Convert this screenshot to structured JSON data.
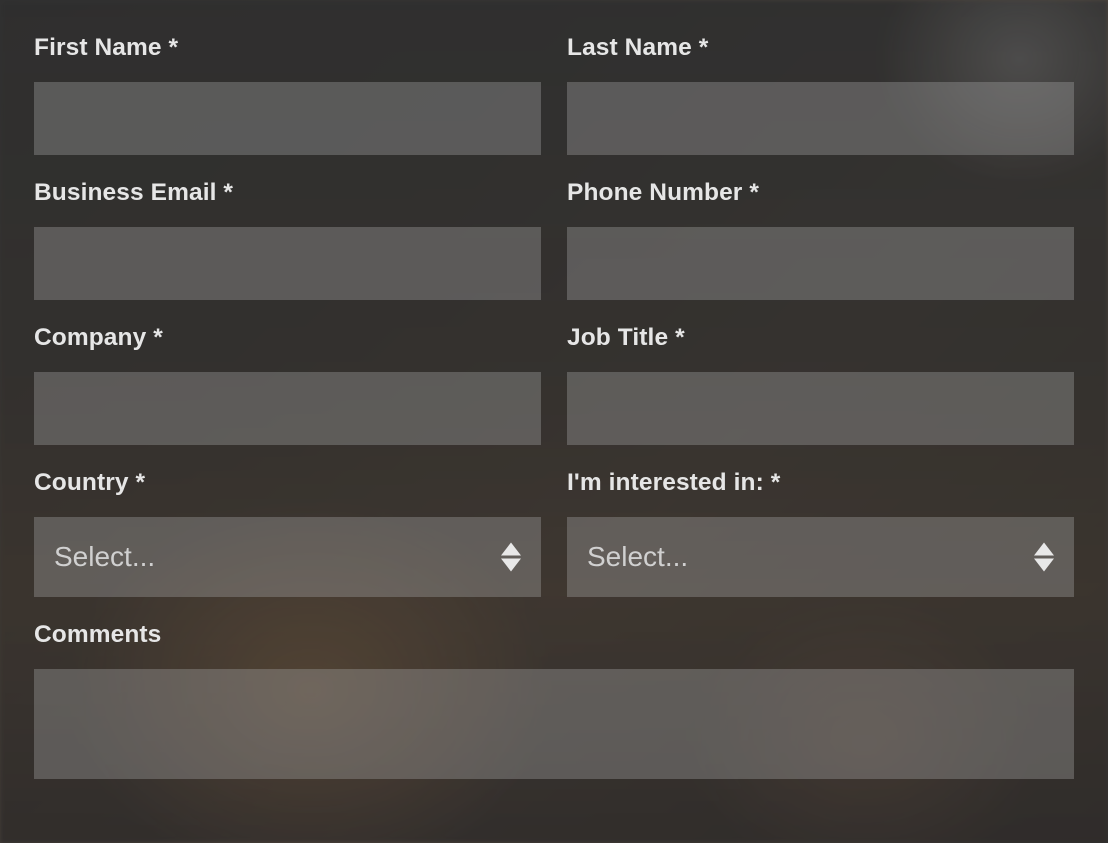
{
  "form": {
    "first_name": {
      "label": "First Name *",
      "value": ""
    },
    "last_name": {
      "label": "Last Name *",
      "value": ""
    },
    "business_email": {
      "label": "Business Email *",
      "value": ""
    },
    "phone_number": {
      "label": "Phone Number *",
      "value": ""
    },
    "company": {
      "label": "Company *",
      "value": ""
    },
    "job_title": {
      "label": "Job Title *",
      "value": ""
    },
    "country": {
      "label": "Country *",
      "selected": "Select..."
    },
    "interested_in": {
      "label": "I'm interested in: *",
      "selected": "Select..."
    },
    "comments": {
      "label": "Comments",
      "value": ""
    }
  }
}
